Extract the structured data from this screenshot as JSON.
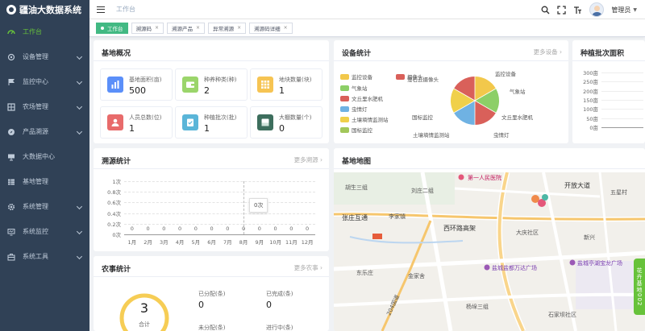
{
  "app": {
    "title": "疆油大数据系统"
  },
  "sidebar": {
    "items": [
      {
        "label": "工作台",
        "icon": "dashboard-icon",
        "active": true,
        "expandable": false
      },
      {
        "label": "设备管理",
        "icon": "device-icon",
        "expandable": true
      },
      {
        "label": "监控中心",
        "icon": "flag-icon",
        "expandable": true
      },
      {
        "label": "农场管理",
        "icon": "grid-icon",
        "expandable": true
      },
      {
        "label": "产品溯源",
        "icon": "compass-icon",
        "expandable": true
      },
      {
        "label": "大数据中心",
        "icon": "screen-icon",
        "expandable": false
      },
      {
        "label": "基地管理",
        "icon": "table-icon",
        "expandable": false
      },
      {
        "label": "系统管理",
        "icon": "gear-icon",
        "expandable": true
      },
      {
        "label": "系统监控",
        "icon": "monitor-icon",
        "expandable": true
      },
      {
        "label": "系统工具",
        "icon": "toolbox-icon",
        "expandable": true
      }
    ]
  },
  "header": {
    "breadcrumb": "工作台",
    "user_name": "管理员"
  },
  "tags": [
    {
      "label": "工作台",
      "active": true
    },
    {
      "label": "溯源码",
      "active": false
    },
    {
      "label": "溯源产品",
      "active": false
    },
    {
      "label": "异常溯源",
      "active": false
    },
    {
      "label": "溯源码详细",
      "active": false
    }
  ],
  "overview": {
    "title": "基地概况",
    "stats": [
      {
        "label": "基地面积(亩)",
        "value": "500",
        "color": "#5b8ff9",
        "icon": "bar-chart-icon"
      },
      {
        "label": "种养种类(种)",
        "value": "2",
        "color": "#9bd56b",
        "icon": "wallet-icon"
      },
      {
        "label": "地块数量(块)",
        "value": "1",
        "color": "#f6c453",
        "icon": "grid-icon"
      },
      {
        "label": "人员总数(位)",
        "value": "1",
        "color": "#e86b6b",
        "icon": "person-icon"
      },
      {
        "label": "种植批次(批)",
        "value": "1",
        "color": "#5ab5d8",
        "icon": "clipboard-icon"
      },
      {
        "label": "大棚数量(个)",
        "value": "0",
        "color": "#3d6e5d",
        "icon": "tray-icon"
      }
    ]
  },
  "devices": {
    "title": "设备统计",
    "more": "更多设备",
    "legend": [
      "监控设备",
      "气象站",
      "文丘里水肥机",
      "虫情灯",
      "土壤墒情监测站",
      "国标监控",
      "摄像头",
      "萤石云摄像头"
    ],
    "slice_labels": [
      "监控设备",
      "气象站",
      "文丘里水肥机",
      "虫情灯",
      "土壤墒情监测站",
      "国标监控"
    ],
    "colors": [
      "#f2c84b",
      "#8ccf67",
      "#d9605a",
      "#6fb2e3",
      "#f0d04a",
      "#a2c75a",
      "#d9605a",
      "#d9605a"
    ]
  },
  "planting": {
    "title": "种植批次面积",
    "y_ticks": [
      "300亩",
      "250亩",
      "200亩",
      "150亩",
      "100亩",
      "50亩",
      "0亩"
    ]
  },
  "trace": {
    "title": "溯源统计",
    "more": "更多溯源",
    "tooltip": "0次",
    "y_ticks": [
      "1次",
      "0.8次",
      "0.6次",
      "0.4次",
      "0.2次",
      "0次"
    ]
  },
  "chart_data": {
    "type": "line",
    "title": "溯源统计",
    "categories": [
      "1月",
      "2月",
      "3月",
      "4月",
      "5月",
      "6月",
      "7月",
      "8月",
      "9月",
      "10月",
      "11月",
      "12月"
    ],
    "series": [
      {
        "values": [
          0,
          0,
          0,
          0,
          0,
          0,
          0,
          0,
          0,
          0,
          0,
          0
        ]
      }
    ],
    "ylim": [
      0,
      1
    ],
    "grid": true
  },
  "map": {
    "title": "基地地图",
    "labels": {
      "l1": "第一人民医院",
      "l2": "开放大道",
      "l3": "五星村",
      "l4": "张庄互通",
      "l5": "李家镇",
      "l6": "西环路高架",
      "l7": "大庆社区",
      "l8": "盐城盐都万达广场",
      "l9": "盐城亭湖宝龙广场",
      "l10": "东乐庄",
      "l11": "金家舍",
      "l12": "杨垛三组",
      "l13": "204国道",
      "l14": "石家坝社区",
      "l15": "胡生三组",
      "l16": "刘庄二组",
      "l17": "新兴"
    }
  },
  "farm": {
    "title": "农事统计",
    "more": "更多农事",
    "total_value": "3",
    "total_label": "合计",
    "assigned_label": "已分配(条)",
    "assigned_value": "0",
    "completed_label": "已完成(条)",
    "completed_value": "0",
    "unassigned_label": "未分配(条)",
    "in_progress_label": "进行中(条)"
  },
  "side_tab": {
    "label": "花卉基地002"
  }
}
